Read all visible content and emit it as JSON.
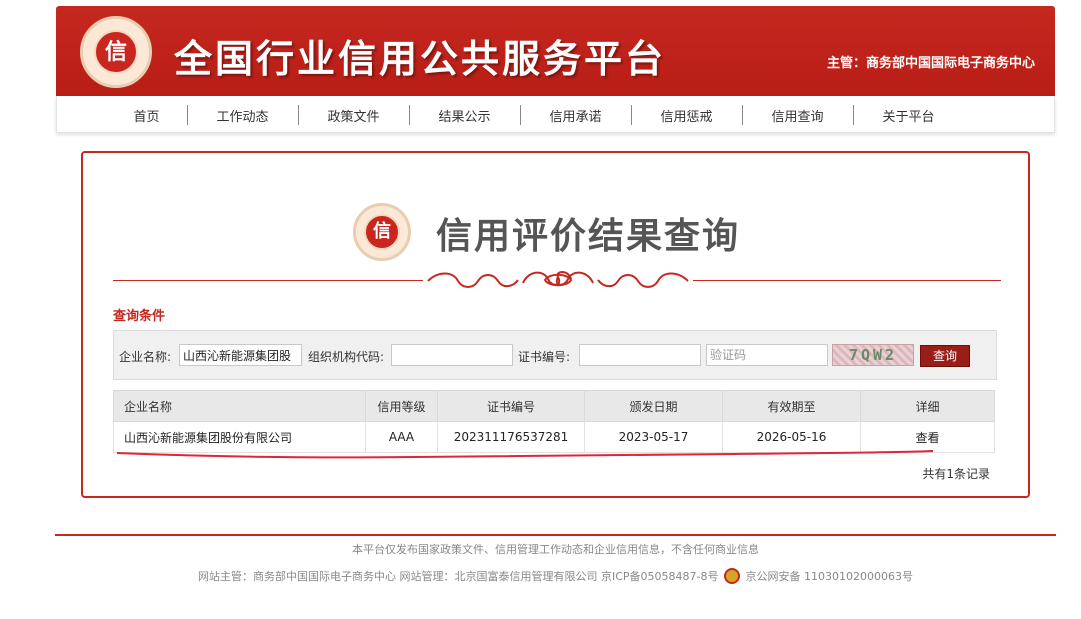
{
  "header": {
    "logo_char": "信",
    "site_title": "全国行业信用公共服务平台",
    "sponsor": "主管：商务部中国国际电子商务中心"
  },
  "nav": {
    "items": [
      "首页",
      "工作动态",
      "政策文件",
      "结果公示",
      "信用承诺",
      "信用惩戒",
      "信用查询",
      "关于平台"
    ]
  },
  "panel": {
    "emblem_char": "信",
    "title": "信用评价结果查询",
    "conditions_label": "查询条件"
  },
  "search": {
    "company_label": "企业名称:",
    "company_value": "山西沁新能源集团股",
    "org_code_label": "组织机构代码:",
    "org_code_value": "",
    "cert_no_label": "证书编号:",
    "cert_no_value": "",
    "captcha_placeholder": "验证码",
    "captcha_image_text": "7QW2",
    "query_button": "查询"
  },
  "results": {
    "headers": [
      "企业名称",
      "信用等级",
      "证书编号",
      "颁发日期",
      "有效期至",
      "详细"
    ],
    "rows": [
      [
        "山西沁新能源集团股份有限公司",
        "AAA",
        "202311176537281",
        "2023-05-17",
        "2026-05-16",
        "查看"
      ]
    ],
    "total": "共有1条记录"
  },
  "footer": {
    "line1": "本平台仅发布国家政策文件、信用管理工作动态和企业信用信息，不含任何商业信息",
    "line2_a": "网站主管：商务部中国国际电子商务中心 网站管理：北京国富泰信用管理有限公司 京ICP备05058487-8号",
    "line2_b": "京公网安备 11030102000063号"
  },
  "colors": {
    "brand_red": "#c5281f",
    "button_dark_red": "#9a1e18"
  }
}
